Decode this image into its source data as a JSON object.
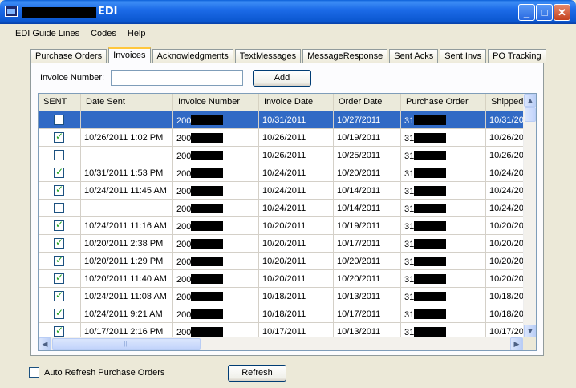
{
  "window": {
    "title": "EDI"
  },
  "menu": [
    "EDI Guide Lines",
    "Codes",
    "Help"
  ],
  "tabs": [
    "Purchase Orders",
    "Invoices",
    "Acknowledgments",
    "TextMessages",
    "MessageResponse",
    "Sent Acks",
    "Sent Invs",
    "PO Tracking"
  ],
  "active_tab": "Invoices",
  "invoice_form": {
    "label": "Invoice Number:",
    "value": "",
    "add_label": "Add"
  },
  "grid": {
    "columns": [
      "SENT",
      "Date Sent",
      "Invoice Number",
      "Invoice Date",
      "Order Date",
      "Purchase Order",
      "Shipped"
    ],
    "rows": [
      {
        "sent": false,
        "date_sent": "",
        "invoice": "200",
        "invoice_date": "10/31/2011",
        "order_date": "10/27/2011",
        "po": "31",
        "shipped": "10/31/20",
        "selected": true
      },
      {
        "sent": true,
        "date_sent": "10/26/2011 1:02 PM",
        "invoice": "200",
        "invoice_date": "10/26/2011",
        "order_date": "10/19/2011",
        "po": "31",
        "shipped": "10/26/20"
      },
      {
        "sent": false,
        "date_sent": "",
        "invoice": "200",
        "invoice_date": "10/26/2011",
        "order_date": "10/25/2011",
        "po": "31",
        "shipped": "10/26/20"
      },
      {
        "sent": true,
        "date_sent": "10/31/2011 1:53 PM",
        "invoice": "200",
        "invoice_date": "10/24/2011",
        "order_date": "10/20/2011",
        "po": "31",
        "shipped": "10/24/20"
      },
      {
        "sent": true,
        "date_sent": "10/24/2011 11:45 AM",
        "invoice": "200",
        "invoice_date": "10/24/2011",
        "order_date": "10/14/2011",
        "po": "31",
        "shipped": "10/24/20"
      },
      {
        "sent": false,
        "date_sent": "",
        "invoice": "200",
        "invoice_date": "10/24/2011",
        "order_date": "10/14/2011",
        "po": "31",
        "shipped": "10/24/20"
      },
      {
        "sent": true,
        "date_sent": "10/24/2011 11:16 AM",
        "invoice": "200",
        "invoice_date": "10/20/2011",
        "order_date": "10/19/2011",
        "po": "31",
        "shipped": "10/20/20"
      },
      {
        "sent": true,
        "date_sent": "10/20/2011 2:38 PM",
        "invoice": "200",
        "invoice_date": "10/20/2011",
        "order_date": "10/17/2011",
        "po": "31",
        "shipped": "10/20/20"
      },
      {
        "sent": true,
        "date_sent": "10/20/2011 1:29 PM",
        "invoice": "200",
        "invoice_date": "10/20/2011",
        "order_date": "10/20/2011",
        "po": "31",
        "shipped": "10/20/20"
      },
      {
        "sent": true,
        "date_sent": "10/20/2011 11:40 AM",
        "invoice": "200",
        "invoice_date": "10/20/2011",
        "order_date": "10/20/2011",
        "po": "31",
        "shipped": "10/20/20"
      },
      {
        "sent": true,
        "date_sent": "10/24/2011 11:08 AM",
        "invoice": "200",
        "invoice_date": "10/18/2011",
        "order_date": "10/13/2011",
        "po": "31",
        "shipped": "10/18/20"
      },
      {
        "sent": true,
        "date_sent": "10/24/2011 9:21 AM",
        "invoice": "200",
        "invoice_date": "10/18/2011",
        "order_date": "10/17/2011",
        "po": "31",
        "shipped": "10/18/20"
      },
      {
        "sent": true,
        "date_sent": "10/17/2011 2:16 PM",
        "invoice": "200",
        "invoice_date": "10/17/2011",
        "order_date": "10/13/2011",
        "po": "31",
        "shipped": "10/17/20"
      }
    ]
  },
  "footer": {
    "auto_refresh_label": "Auto Refresh Purchase Orders",
    "auto_refresh_checked": false,
    "refresh_label": "Refresh"
  },
  "colors": {
    "titlebar": "#0b57d0",
    "selection": "#316ac5",
    "panel": "#ece9d8",
    "tab_highlight": "#ffc73c"
  }
}
